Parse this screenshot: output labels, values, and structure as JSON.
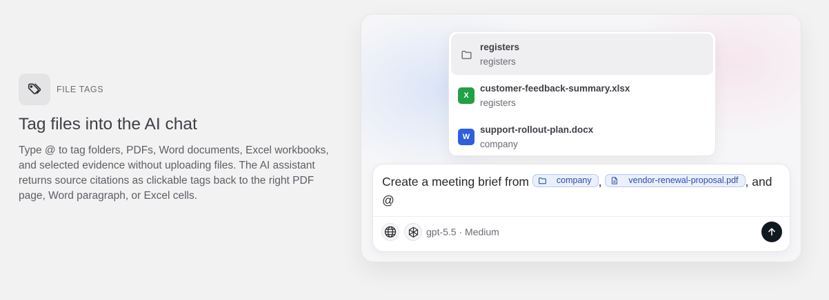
{
  "feature": {
    "eyebrow": "FILE TAGS",
    "title": "Tag files into the AI chat",
    "description": "Type @ to tag folders, PDFs, Word documents, Excel workbooks, and selected evidence without uploading files. The AI assistant returns source citations as clickable tags back to the right PDF page, Word paragraph, or Excel cells."
  },
  "mention_menu": {
    "items": [
      {
        "name": "registers",
        "subtitle": "registers",
        "icon": "folder-icon"
      },
      {
        "name": "customer-feedback-summary.xlsx",
        "subtitle": "registers",
        "icon": "excel-icon",
        "badge": "X"
      },
      {
        "name": "support-rollout-plan.docx",
        "subtitle": "company",
        "icon": "word-icon",
        "badge": "W"
      }
    ]
  },
  "composer": {
    "text_before": "Create a meeting brief from",
    "chip_folder": "company",
    "separator": ",",
    "chip_file": "vendor-renewal-proposal.pdf",
    "text_after": ", and",
    "mention_trigger": "@",
    "model_label": "gpt-5.5 · Medium"
  },
  "colors": {
    "background": "#f2f2f2",
    "chip_bg": "#eaf0fc",
    "chip_border": "#b7c9ef",
    "excel_green": "#22a046",
    "word_blue": "#2f5fdc",
    "send_button": "#101820"
  }
}
